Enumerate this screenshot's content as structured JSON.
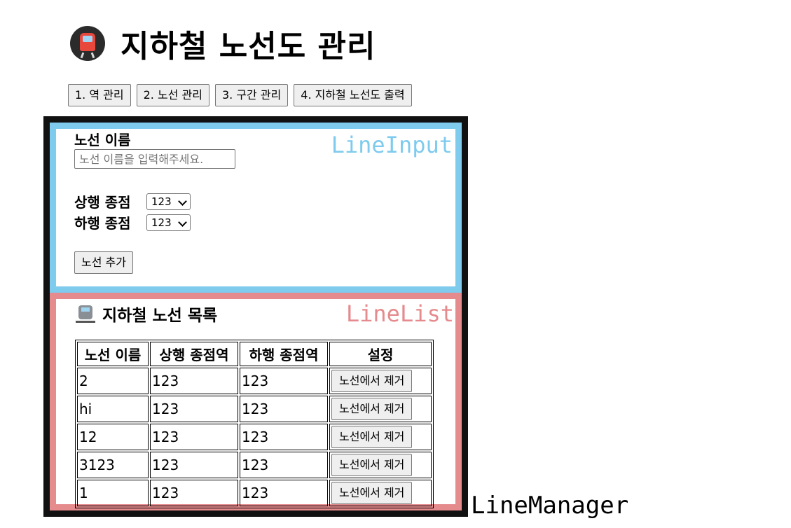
{
  "app": {
    "title": "지하철 노선도 관리",
    "title_icon": "metro-icon"
  },
  "nav": {
    "buttons": [
      {
        "label": "1. 역 관리"
      },
      {
        "label": "2. 노선 관리"
      },
      {
        "label": "3. 구간 관리"
      },
      {
        "label": "4. 지하철 노선도 출력"
      }
    ]
  },
  "line_input": {
    "component_tag": "LineInput",
    "name_label": "노선 이름",
    "name_value": "",
    "name_placeholder": "노선 이름을 입력해주세요.",
    "up_label": "상행 종점",
    "up_selected": "123",
    "down_label": "하행 종점",
    "down_selected": "123",
    "add_button": "노선 추가"
  },
  "line_list": {
    "component_tag": "LineList",
    "title": "지하철 노선 목록",
    "title_icon": "railway-car-icon",
    "columns": [
      "노선 이름",
      "상행 종점역",
      "하행 종점역",
      "설정"
    ],
    "rows": [
      {
        "name": "2",
        "up": "123",
        "down": "123",
        "action": "노선에서 제거"
      },
      {
        "name": "hi",
        "up": "123",
        "down": "123",
        "action": "노선에서 제거"
      },
      {
        "name": "12",
        "up": "123",
        "down": "123",
        "action": "노선에서 제거"
      },
      {
        "name": "3123",
        "up": "123",
        "down": "123",
        "action": "노선에서 제거"
      },
      {
        "name": "1",
        "up": "123",
        "down": "123",
        "action": "노선에서 제거"
      }
    ]
  },
  "manager": {
    "component_tag": "LineManager"
  },
  "colors": {
    "line_input_border": "#7ecbee",
    "line_list_border": "#e58a8d",
    "manager_border": "#111111"
  }
}
